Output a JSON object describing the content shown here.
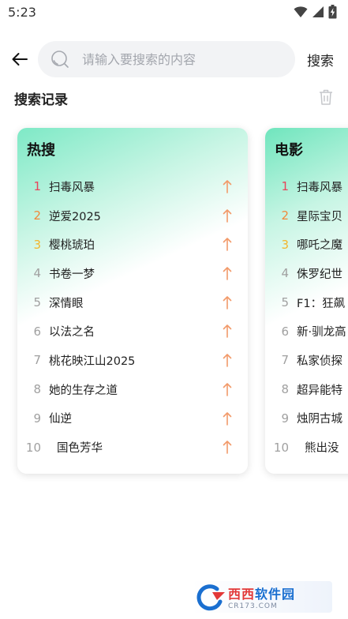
{
  "status_bar": {
    "time": "5:23",
    "icons": [
      "wifi-icon",
      "signal-icon",
      "battery-charging-icon"
    ]
  },
  "search": {
    "placeholder": "请输入要搜索的内容",
    "value": "",
    "button_label": "搜索"
  },
  "history": {
    "title": "搜索记录"
  },
  "cards": [
    {
      "title": "热搜",
      "items": [
        {
          "rank": "1",
          "title": "扫毒风暴"
        },
        {
          "rank": "2",
          "title": "逆爱2025"
        },
        {
          "rank": "3",
          "title": "樱桃琥珀"
        },
        {
          "rank": "4",
          "title": "书卷一梦"
        },
        {
          "rank": "5",
          "title": "深情眼"
        },
        {
          "rank": "6",
          "title": "以法之名"
        },
        {
          "rank": "7",
          "title": "桃花映江山2025"
        },
        {
          "rank": "8",
          "title": "她的生存之道"
        },
        {
          "rank": "9",
          "title": "仙逆"
        },
        {
          "rank": "10",
          "title": "国色芳华"
        }
      ]
    },
    {
      "title": "电影",
      "items": [
        {
          "rank": "1",
          "title": "扫毒风暴"
        },
        {
          "rank": "2",
          "title": "星际宝贝"
        },
        {
          "rank": "3",
          "title": "哪吒之魔"
        },
        {
          "rank": "4",
          "title": "侏罗纪世"
        },
        {
          "rank": "5",
          "title": "F1：狂飙"
        },
        {
          "rank": "6",
          "title": "新·驯龙高"
        },
        {
          "rank": "7",
          "title": "私家侦探"
        },
        {
          "rank": "8",
          "title": "超异能特"
        },
        {
          "rank": "9",
          "title": "烛阴古城"
        },
        {
          "rank": "10",
          "title": "熊出没"
        }
      ]
    }
  ],
  "colors": {
    "rank1": "#e8455b",
    "rank2": "#f0883a",
    "rank3": "#f2b52c",
    "rank_other": "#a0a0a0",
    "trend_up": "#f29a6a",
    "card_gradient": "#7ee9c6",
    "search_bg": "#f2f3f5"
  },
  "watermark": {
    "name_part1": "西西",
    "name_part2": "软件园",
    "url": "CR173.COM"
  }
}
